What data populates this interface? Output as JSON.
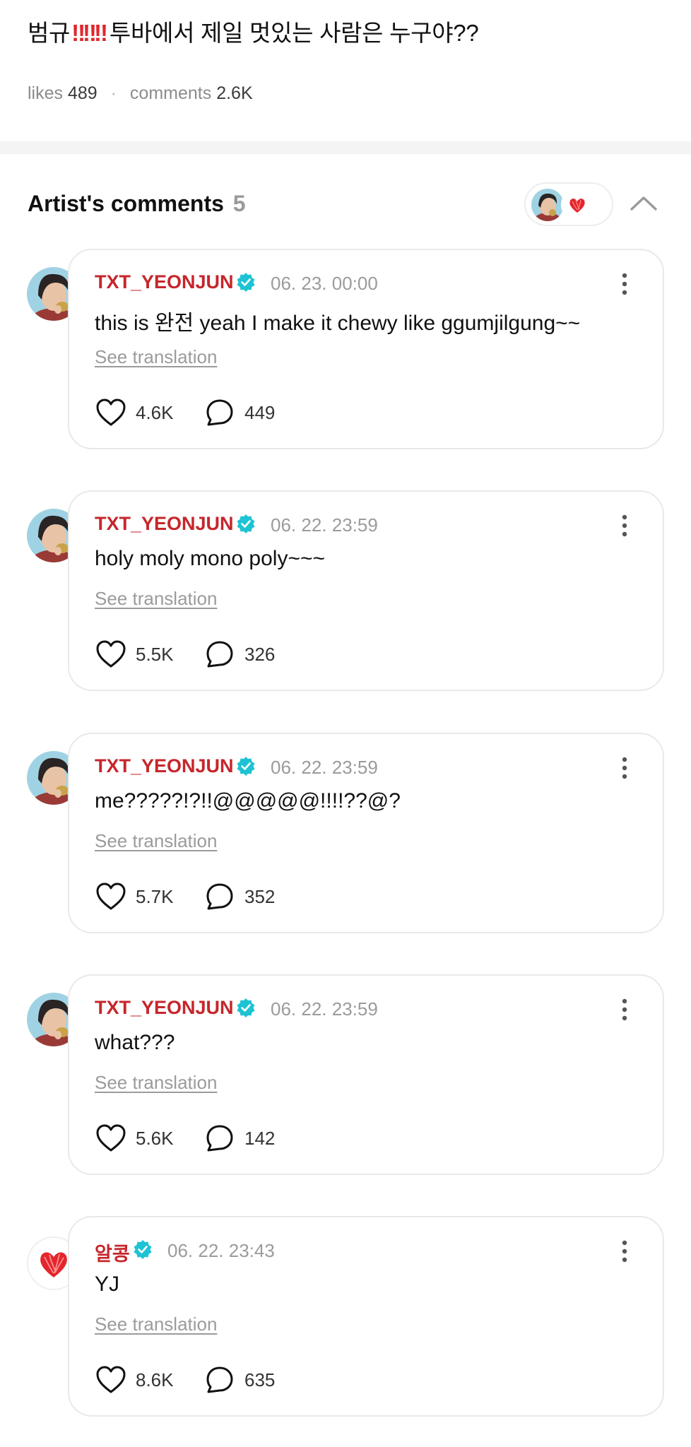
{
  "post": {
    "title_start": "범규",
    "title_bangs": "‼‼‼",
    "title_end": "투바에서 제일 멋있는 사람은 누구야??",
    "likes_label": "likes",
    "likes_value": "489",
    "separator": "·",
    "comments_label": "comments",
    "comments_value": "2.6K"
  },
  "artist_comments": {
    "title": "Artist's comments",
    "count": "5"
  },
  "icons": {
    "verified": "verified-check-icon",
    "like": "heart-outline-icon",
    "comment": "speech-bubble-icon",
    "more": "kebab-menu-icon",
    "collapse": "chevron-up-icon"
  },
  "colors": {
    "author": "#c6262c",
    "verified": "#1ec3d3",
    "bang": "#e0262c",
    "muted": "#9b9b9b"
  },
  "comments": [
    {
      "author": "TXT_YEONJUN",
      "time": "06. 23. 00:00",
      "text": "this is 완전 yeah I make it chewy like ggumjilgung~~",
      "translate": "See translation",
      "likes": "4.6K",
      "replies": "449",
      "avatar": "person-photo"
    },
    {
      "author": "TXT_YEONJUN",
      "time": "06. 22. 23:59",
      "text": "holy moly mono poly~~~",
      "translate": "See translation",
      "likes": "5.5K",
      "replies": "326",
      "avatar": "person-photo"
    },
    {
      "author": "TXT_YEONJUN",
      "time": "06. 22. 23:59",
      "text": "me?????!?!!@@@@@!!!!??@?",
      "translate": "See translation",
      "likes": "5.7K",
      "replies": "352",
      "avatar": "person-photo"
    },
    {
      "author": "TXT_YEONJUN",
      "time": "06. 22. 23:59",
      "text": "what???",
      "translate": "See translation",
      "likes": "5.6K",
      "replies": "142",
      "avatar": "person-photo"
    },
    {
      "author": "알콩",
      "time": "06. 22. 23:43",
      "text": "YJ",
      "translate": "See translation",
      "likes": "8.6K",
      "replies": "635",
      "avatar": "red-heart"
    }
  ]
}
